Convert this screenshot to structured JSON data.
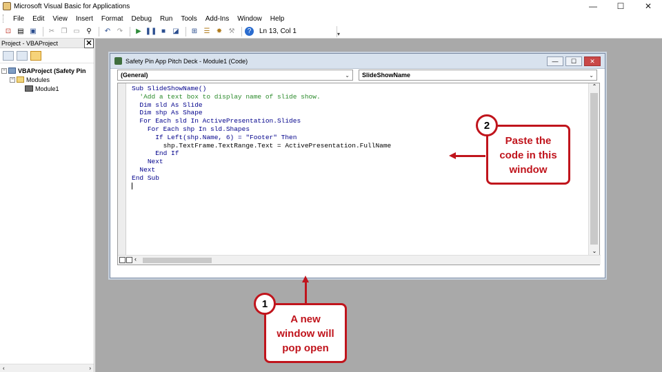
{
  "app": {
    "title": "Microsoft Visual Basic for Applications"
  },
  "window_controls": [
    "—",
    "☐",
    "✕"
  ],
  "menu": [
    "File",
    "Edit",
    "View",
    "Insert",
    "Format",
    "Debug",
    "Run",
    "Tools",
    "Add-Ins",
    "Window",
    "Help"
  ],
  "toolbar": {
    "position": "Ln 13, Col 1"
  },
  "project": {
    "title": "Project - VBAProject",
    "close": "✕",
    "tree": {
      "root": "VBAProject (Safety Pin",
      "folder": "Modules",
      "module": "Module1"
    }
  },
  "codewin": {
    "title": "Safety Pin App Pitch Deck - Module1 (Code)",
    "object_combo": "(General)",
    "proc_combo": "SlideShowName",
    "lines": [
      {
        "indent": "",
        "parts": [
          {
            "t": "Sub SlideShowName()",
            "c": "kw"
          }
        ]
      },
      {
        "indent": "  ",
        "parts": [
          {
            "t": "'Add a text box to display name of slide show.",
            "c": "cm"
          }
        ]
      },
      {
        "indent": "  ",
        "parts": [
          {
            "t": "Dim sld As Slide",
            "c": "kw"
          }
        ]
      },
      {
        "indent": "  ",
        "parts": [
          {
            "t": "Dim shp As Shape",
            "c": "kw"
          }
        ]
      },
      {
        "indent": "  ",
        "parts": [
          {
            "t": "For Each sld In ActivePresentation.Slides",
            "c": "kw"
          }
        ]
      },
      {
        "indent": "    ",
        "parts": [
          {
            "t": "For Each shp In sld.Shapes",
            "c": "kw"
          }
        ]
      },
      {
        "indent": "      ",
        "parts": [
          {
            "t": "If Left(shp.Name, 6) = \"Footer\" Then",
            "c": "kw"
          }
        ]
      },
      {
        "indent": "        ",
        "parts": [
          {
            "t": "shp.TextFrame.TextRange.Text = ActivePresentation.FullName",
            "c": ""
          }
        ]
      },
      {
        "indent": "      ",
        "parts": [
          {
            "t": "End If",
            "c": "kw"
          }
        ]
      },
      {
        "indent": "    ",
        "parts": [
          {
            "t": "Next",
            "c": "kw"
          }
        ]
      },
      {
        "indent": "  ",
        "parts": [
          {
            "t": "Next",
            "c": "kw"
          }
        ]
      },
      {
        "indent": "",
        "parts": [
          {
            "t": "End Sub",
            "c": "kw"
          }
        ]
      }
    ]
  },
  "callouts": {
    "one": {
      "number": "1",
      "text_lines": [
        "A new",
        "window will",
        "pop open"
      ]
    },
    "two": {
      "number": "2",
      "text_lines": [
        "Paste the",
        "code in this",
        "window"
      ]
    }
  },
  "colors": {
    "accent": "#c0141c",
    "mdi_bg": "#a9a9a9",
    "keyword": "#00008b",
    "comment": "#2a8a2a"
  }
}
